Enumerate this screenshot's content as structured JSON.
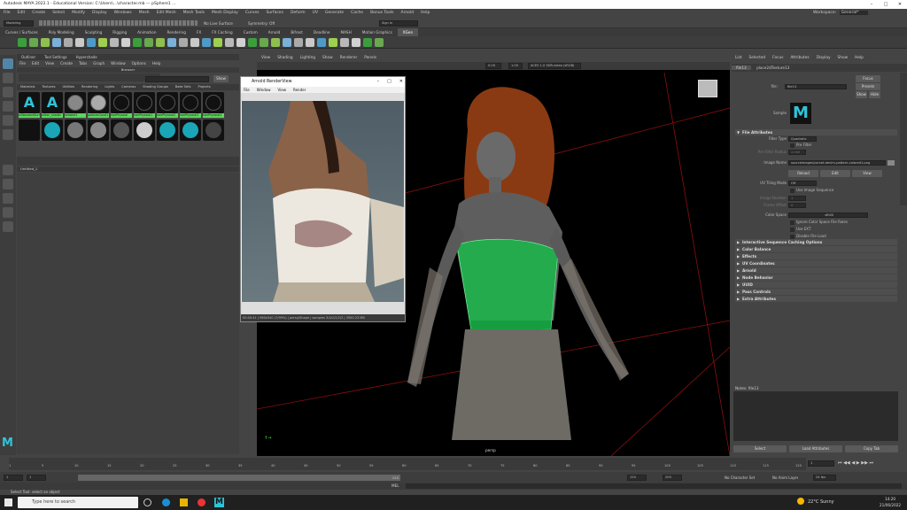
{
  "window": {
    "title": "Autodesk MAYA 2022.1 - Educational Version: C:\\Users\\...\\character.mb  ---  pSphere1 ..."
  },
  "workspace": {
    "label": "Workspace:",
    "value": "General*"
  },
  "main_menu": [
    "File",
    "Edit",
    "Create",
    "Select",
    "Modify",
    "Display",
    "Windows",
    "Mesh",
    "Edit Mesh",
    "Mesh Tools",
    "Mesh Display",
    "Curves",
    "Surfaces",
    "Deform",
    "UV",
    "Generate",
    "Cache",
    "Bonus Tools",
    "Arnold",
    "Help"
  ],
  "status_line": {
    "mode": "Modeling",
    "live_surface": "No Live Surface",
    "symmetry": "Symmetry: Off",
    "sign_in": "Sign In"
  },
  "shelf_tabs": [
    "Curves / Surfaces",
    "Poly Modeling",
    "Sculpting",
    "Rigging",
    "Animation",
    "Rendering",
    "FX",
    "FX Caching",
    "Custom",
    "Arnold",
    "Bifrost",
    "Deadline",
    "MASH",
    "Motion Graphics",
    "XGen"
  ],
  "shelf_active": "XGen",
  "hypershade": {
    "tabs": [
      "Outliner",
      "Tool Settings",
      "Hypershade"
    ],
    "menu": [
      "File",
      "Edit",
      "View",
      "Create",
      "Tabs",
      "Graph",
      "Window",
      "Options",
      "Help"
    ],
    "browser_label": "Browser",
    "show_label": "Show",
    "sub_tabs": [
      "Materials",
      "Textures",
      "Utilities",
      "Rendering",
      "Lights",
      "Cameras",
      "Shading Groups",
      "Bake Sets",
      "Projects"
    ],
    "materials": [
      "aiStandardSurf",
      "aiHair_shader",
      "lambert1",
      "particleCloud1",
      "hairPhysical",
      "hairPhysical1",
      "hairPhysical2",
      "hairPhysical3",
      "hairPhysical4"
    ],
    "workarea_tab": "Untitled_1"
  },
  "viewport": {
    "menu": [
      "View",
      "Shading",
      "Lighting",
      "Show",
      "Renderer",
      "Panels"
    ],
    "exposure": "0.00",
    "gamma": "1.00",
    "colorspace": "ACES 1.0 SDR-video (sRGB)",
    "camera_label": "persp"
  },
  "render_view": {
    "title": "Arnold RenderView",
    "menu": [
      "File",
      "Window",
      "View",
      "Render"
    ],
    "status": "00:00:41 | 960x540 (7/99%) | persp/Shape | samples 3/4/2/2/2/2 | 3500.23 MB"
  },
  "attribute_editor": {
    "menu": [
      "List",
      "Selected",
      "Focus",
      "Attributes",
      "Display",
      "Show",
      "Help"
    ],
    "node_tab": "file13",
    "node_tab2": "place2dTexture13",
    "node_label": "file:",
    "node_value": "file13",
    "focus_btn": "Focus",
    "presets_btn": "Presets",
    "show_btn": "Show",
    "hide_btn": "Hide",
    "sample_label": "Sample",
    "file_attributes": "File Attributes",
    "filter_type_label": "Filter Type",
    "filter_type_value": "Quadratic",
    "prefilter_label": "Pre Filter",
    "prefilter_radius_label": "Pre Filter Radius",
    "prefilter_radius_value": "2.000",
    "image_name_label": "Image Name",
    "image_name_value": "sourceimages/corset-denim-pattern-colored1.png",
    "reload_btn": "Reload",
    "edit_btn": "Edit",
    "view_btn": "View",
    "uv_tiling_label": "UV Tiling Mode",
    "uv_tiling_value": "Off",
    "use_sequence_label": "Use Image Sequence",
    "image_number_label": "Image Number",
    "image_number_value": "1",
    "frame_offset_label": "Frame Offset",
    "frame_offset_value": "0",
    "color_space_label": "Color Space",
    "color_space_value": "sRGB",
    "ignore_cs_label": "Ignore Color Space File Rules",
    "use_exr_label": "Use EXT",
    "disable_load_label": "Disable File Load",
    "sections": [
      "Interactive Sequence Caching Options",
      "Color Balance",
      "Effects",
      "UV Coordinates",
      "Arnold",
      "Node Behavior",
      "UUID",
      "Pass Controls",
      "Extra Attributes"
    ],
    "notes_label": "Notes: file13",
    "select_btn": "Select",
    "load_attr_btn": "Load Attributes",
    "copy_tab_btn": "Copy Tab",
    "side_tabs": [
      "Channel Box / Layer Editor",
      "Modeling Toolkit",
      "Attribute Editor"
    ]
  },
  "timeline": {
    "ticks": [
      "1",
      "5",
      "10",
      "15",
      "20",
      "25",
      "30",
      "35",
      "40",
      "45",
      "50",
      "55",
      "60",
      "65",
      "70",
      "75",
      "80",
      "85",
      "90",
      "95",
      "100",
      "105",
      "110",
      "115",
      "120"
    ],
    "current_frame": "1",
    "range_start": "1",
    "range_start2": "1",
    "range_mid": "120",
    "range_end": "120",
    "range_end2": "200",
    "character_set": "No Character Set",
    "anim_layer": "No Anim Layer",
    "fps": "24 fps"
  },
  "mel": {
    "label": "MEL"
  },
  "help_line": "Select Tool: select an object",
  "taskbar": {
    "search_placeholder": "Type here to search",
    "weather": "22°C  Sunny",
    "time": "14:20",
    "date": "21/06/2022"
  }
}
